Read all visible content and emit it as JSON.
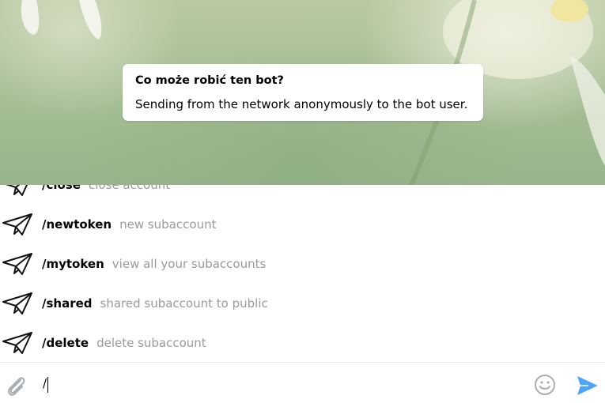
{
  "bot_info": {
    "title": "Co może robić ten bot?",
    "description": "Sending from the network anonymously to the bot user."
  },
  "commands": [
    {
      "name": "/close",
      "description": "close account",
      "icon": "paper-plane-icon"
    },
    {
      "name": "/newtoken",
      "description": "new subaccount",
      "icon": "paper-plane-icon"
    },
    {
      "name": "/mytoken",
      "description": "view all your subaccounts",
      "icon": "paper-plane-icon"
    },
    {
      "name": "/shared",
      "description": "shared subaccount to public",
      "icon": "paper-plane-icon"
    },
    {
      "name": "/delete",
      "description": "delete subaccount",
      "icon": "paper-plane-icon"
    }
  ],
  "compose": {
    "input_value": "/",
    "attach_icon": "paperclip-icon",
    "emoji_icon": "smiley-icon",
    "send_icon": "send-icon"
  },
  "colors": {
    "accent": "#4ea4f6",
    "muted_text": "#9a9a9a",
    "icon_gray": "#a8aeb3"
  }
}
